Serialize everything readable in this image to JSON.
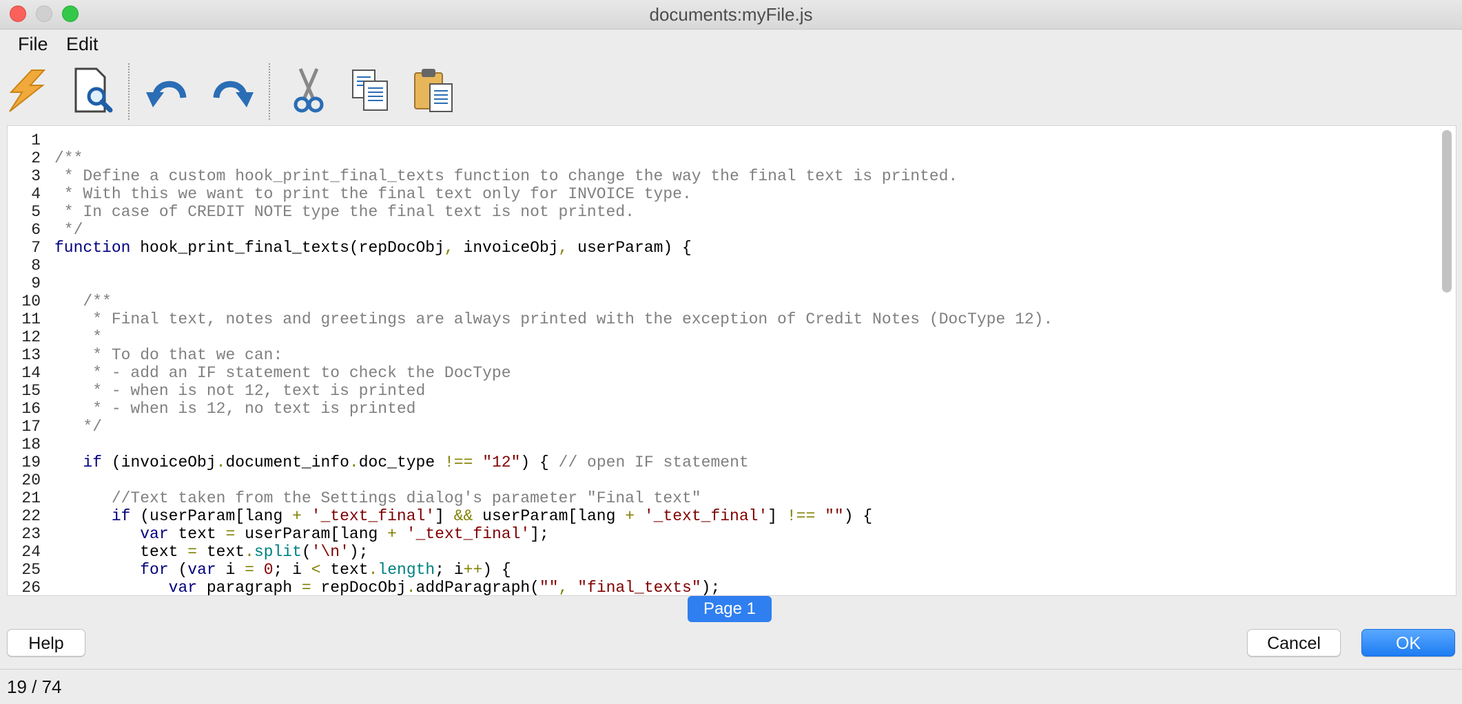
{
  "window": {
    "title": "documents:myFile.js"
  },
  "menu": [
    "File",
    "Edit"
  ],
  "toolbar": {
    "icons": [
      "lightning-icon",
      "preview-icon",
      "undo-icon",
      "redo-icon",
      "cut-icon",
      "copy-icon",
      "paste-icon"
    ]
  },
  "colors": {
    "keyword": "#000080",
    "comment": "#808080",
    "string": "#800000",
    "operator": "#808000",
    "method": "#008080",
    "highlight": "#fbf79a",
    "accent": "#2f7ff0"
  },
  "editor": {
    "highlighted_line": 19,
    "lines": [
      [],
      [
        [
          "c",
          "/**"
        ]
      ],
      [
        [
          "c",
          " * Define a custom hook_print_final_texts function to change the way the final text is printed."
        ]
      ],
      [
        [
          "c",
          " * With this we want to print the final text only for INVOICE type."
        ]
      ],
      [
        [
          "c",
          " * In case of CREDIT NOTE type the final text is not printed."
        ]
      ],
      [
        [
          "c",
          " */"
        ]
      ],
      [
        [
          "k",
          "function"
        ],
        [
          "p",
          " hook_print_final_texts(repDocObj"
        ],
        [
          "o",
          ","
        ],
        [
          "p",
          " invoiceObj"
        ],
        [
          "o",
          ","
        ],
        [
          "p",
          " userParam) {"
        ]
      ],
      [],
      [],
      [
        [
          "c",
          "   /**"
        ]
      ],
      [
        [
          "c",
          "    * Final text, notes and greetings are always printed with the exception of Credit Notes (DocType 12)."
        ]
      ],
      [
        [
          "c",
          "    *"
        ]
      ],
      [
        [
          "c",
          "    * To do that we can:"
        ]
      ],
      [
        [
          "c",
          "    * - add an IF statement to check the DocType"
        ]
      ],
      [
        [
          "c",
          "    * - when is not 12, text is printed"
        ]
      ],
      [
        [
          "c",
          "    * - when is 12, no text is printed"
        ]
      ],
      [
        [
          "c",
          "   */"
        ]
      ],
      [],
      [
        [
          "p",
          "   "
        ],
        [
          "k",
          "if"
        ],
        [
          "p",
          " (invoiceObj"
        ],
        [
          "o",
          "."
        ],
        [
          "p",
          "document_info"
        ],
        [
          "o",
          "."
        ],
        [
          "p",
          "doc_type "
        ],
        [
          "o",
          "!=="
        ],
        [
          "p",
          " "
        ],
        [
          "s",
          "\"12\""
        ],
        [
          "p",
          ") { "
        ],
        [
          "c",
          "// open IF statement"
        ]
      ],
      [],
      [
        [
          "c",
          "      //Text taken from the Settings dialog's parameter \"Final text\""
        ]
      ],
      [
        [
          "p",
          "      "
        ],
        [
          "k",
          "if"
        ],
        [
          "p",
          " (userParam[lang "
        ],
        [
          "o",
          "+"
        ],
        [
          "p",
          " "
        ],
        [
          "s",
          "'_text_final'"
        ],
        [
          "p",
          "] "
        ],
        [
          "o",
          "&&"
        ],
        [
          "p",
          " userParam[lang "
        ],
        [
          "o",
          "+"
        ],
        [
          "p",
          " "
        ],
        [
          "s",
          "'_text_final'"
        ],
        [
          "p",
          "] "
        ],
        [
          "o",
          "!=="
        ],
        [
          "p",
          " "
        ],
        [
          "s",
          "\"\""
        ],
        [
          "p",
          ") {"
        ]
      ],
      [
        [
          "p",
          "         "
        ],
        [
          "k",
          "var"
        ],
        [
          "p",
          " text "
        ],
        [
          "o",
          "="
        ],
        [
          "p",
          " userParam[lang "
        ],
        [
          "o",
          "+"
        ],
        [
          "p",
          " "
        ],
        [
          "s",
          "'_text_final'"
        ],
        [
          "p",
          "];"
        ]
      ],
      [
        [
          "p",
          "         text "
        ],
        [
          "o",
          "="
        ],
        [
          "p",
          " text"
        ],
        [
          "o",
          "."
        ],
        [
          "m",
          "split"
        ],
        [
          "p",
          "("
        ],
        [
          "s",
          "'\\n'"
        ],
        [
          "p",
          ");"
        ]
      ],
      [
        [
          "p",
          "         "
        ],
        [
          "k",
          "for"
        ],
        [
          "p",
          " ("
        ],
        [
          "k",
          "var"
        ],
        [
          "p",
          " i "
        ],
        [
          "o",
          "="
        ],
        [
          "p",
          " "
        ],
        [
          "s",
          "0"
        ],
        [
          "p",
          "; i "
        ],
        [
          "o",
          "<"
        ],
        [
          "p",
          " text"
        ],
        [
          "o",
          "."
        ],
        [
          "m",
          "length"
        ],
        [
          "p",
          "; i"
        ],
        [
          "o",
          "++"
        ],
        [
          "p",
          ") {"
        ]
      ],
      [
        [
          "p",
          "            "
        ],
        [
          "k",
          "var"
        ],
        [
          "p",
          " paragraph "
        ],
        [
          "o",
          "="
        ],
        [
          "p",
          " repDocObj"
        ],
        [
          "o",
          "."
        ],
        [
          "p",
          "addParagraph("
        ],
        [
          "s",
          "\"\""
        ],
        [
          "o",
          ","
        ],
        [
          "p",
          " "
        ],
        [
          "s",
          "\"final_texts\""
        ],
        [
          "p",
          ");"
        ]
      ]
    ]
  },
  "page_button": "Page 1",
  "buttons": {
    "help": "Help",
    "cancel": "Cancel",
    "ok": "OK"
  },
  "status": "19 / 74"
}
